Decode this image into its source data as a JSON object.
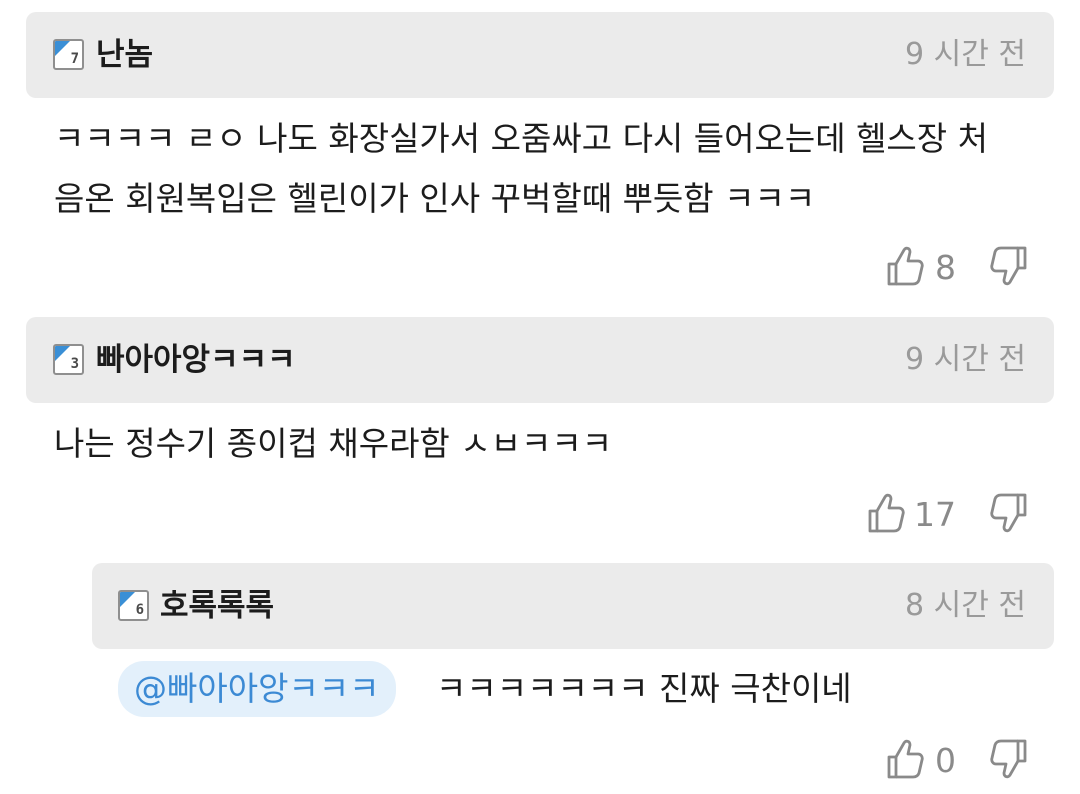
{
  "comments": [
    {
      "level": "7",
      "username": "난놈",
      "time": "9 시간 전",
      "text_line1": "ㅋㅋㅋㅋ ㄹㅇ 나도 화장실가서 오줌싸고 다시 들어오는데 헬스장 처",
      "text_line2": "음온 회원복입은 헬린이가 인사 꾸벅할때 뿌듯함 ㅋㅋㅋ",
      "likes": "8"
    },
    {
      "level": "3",
      "username": "빠아아앙ㅋㅋㅋ",
      "time": "9 시간 전",
      "text_line1": "나는 정수기 종이컵 채우라함 ㅅㅂㅋㅋㅋ",
      "likes": "17"
    },
    {
      "level": "6",
      "username": "호록록록",
      "time": "8 시간 전",
      "mention": "@빠아아앙ㅋㅋㅋ",
      "text_line1": "ㅋㅋㅋㅋㅋㅋㅋ 진짜 극찬이네",
      "likes": "0"
    }
  ],
  "icons": {
    "like": "thumbs-up-icon",
    "dislike": "thumbs-down-icon"
  },
  "colors": {
    "header_bg": "#ebebeb",
    "badge_accent": "#3a8fd6",
    "mention_bg": "#e3f0fb",
    "mention_text": "#3c8ad4",
    "time_text": "#9a9a9a"
  }
}
